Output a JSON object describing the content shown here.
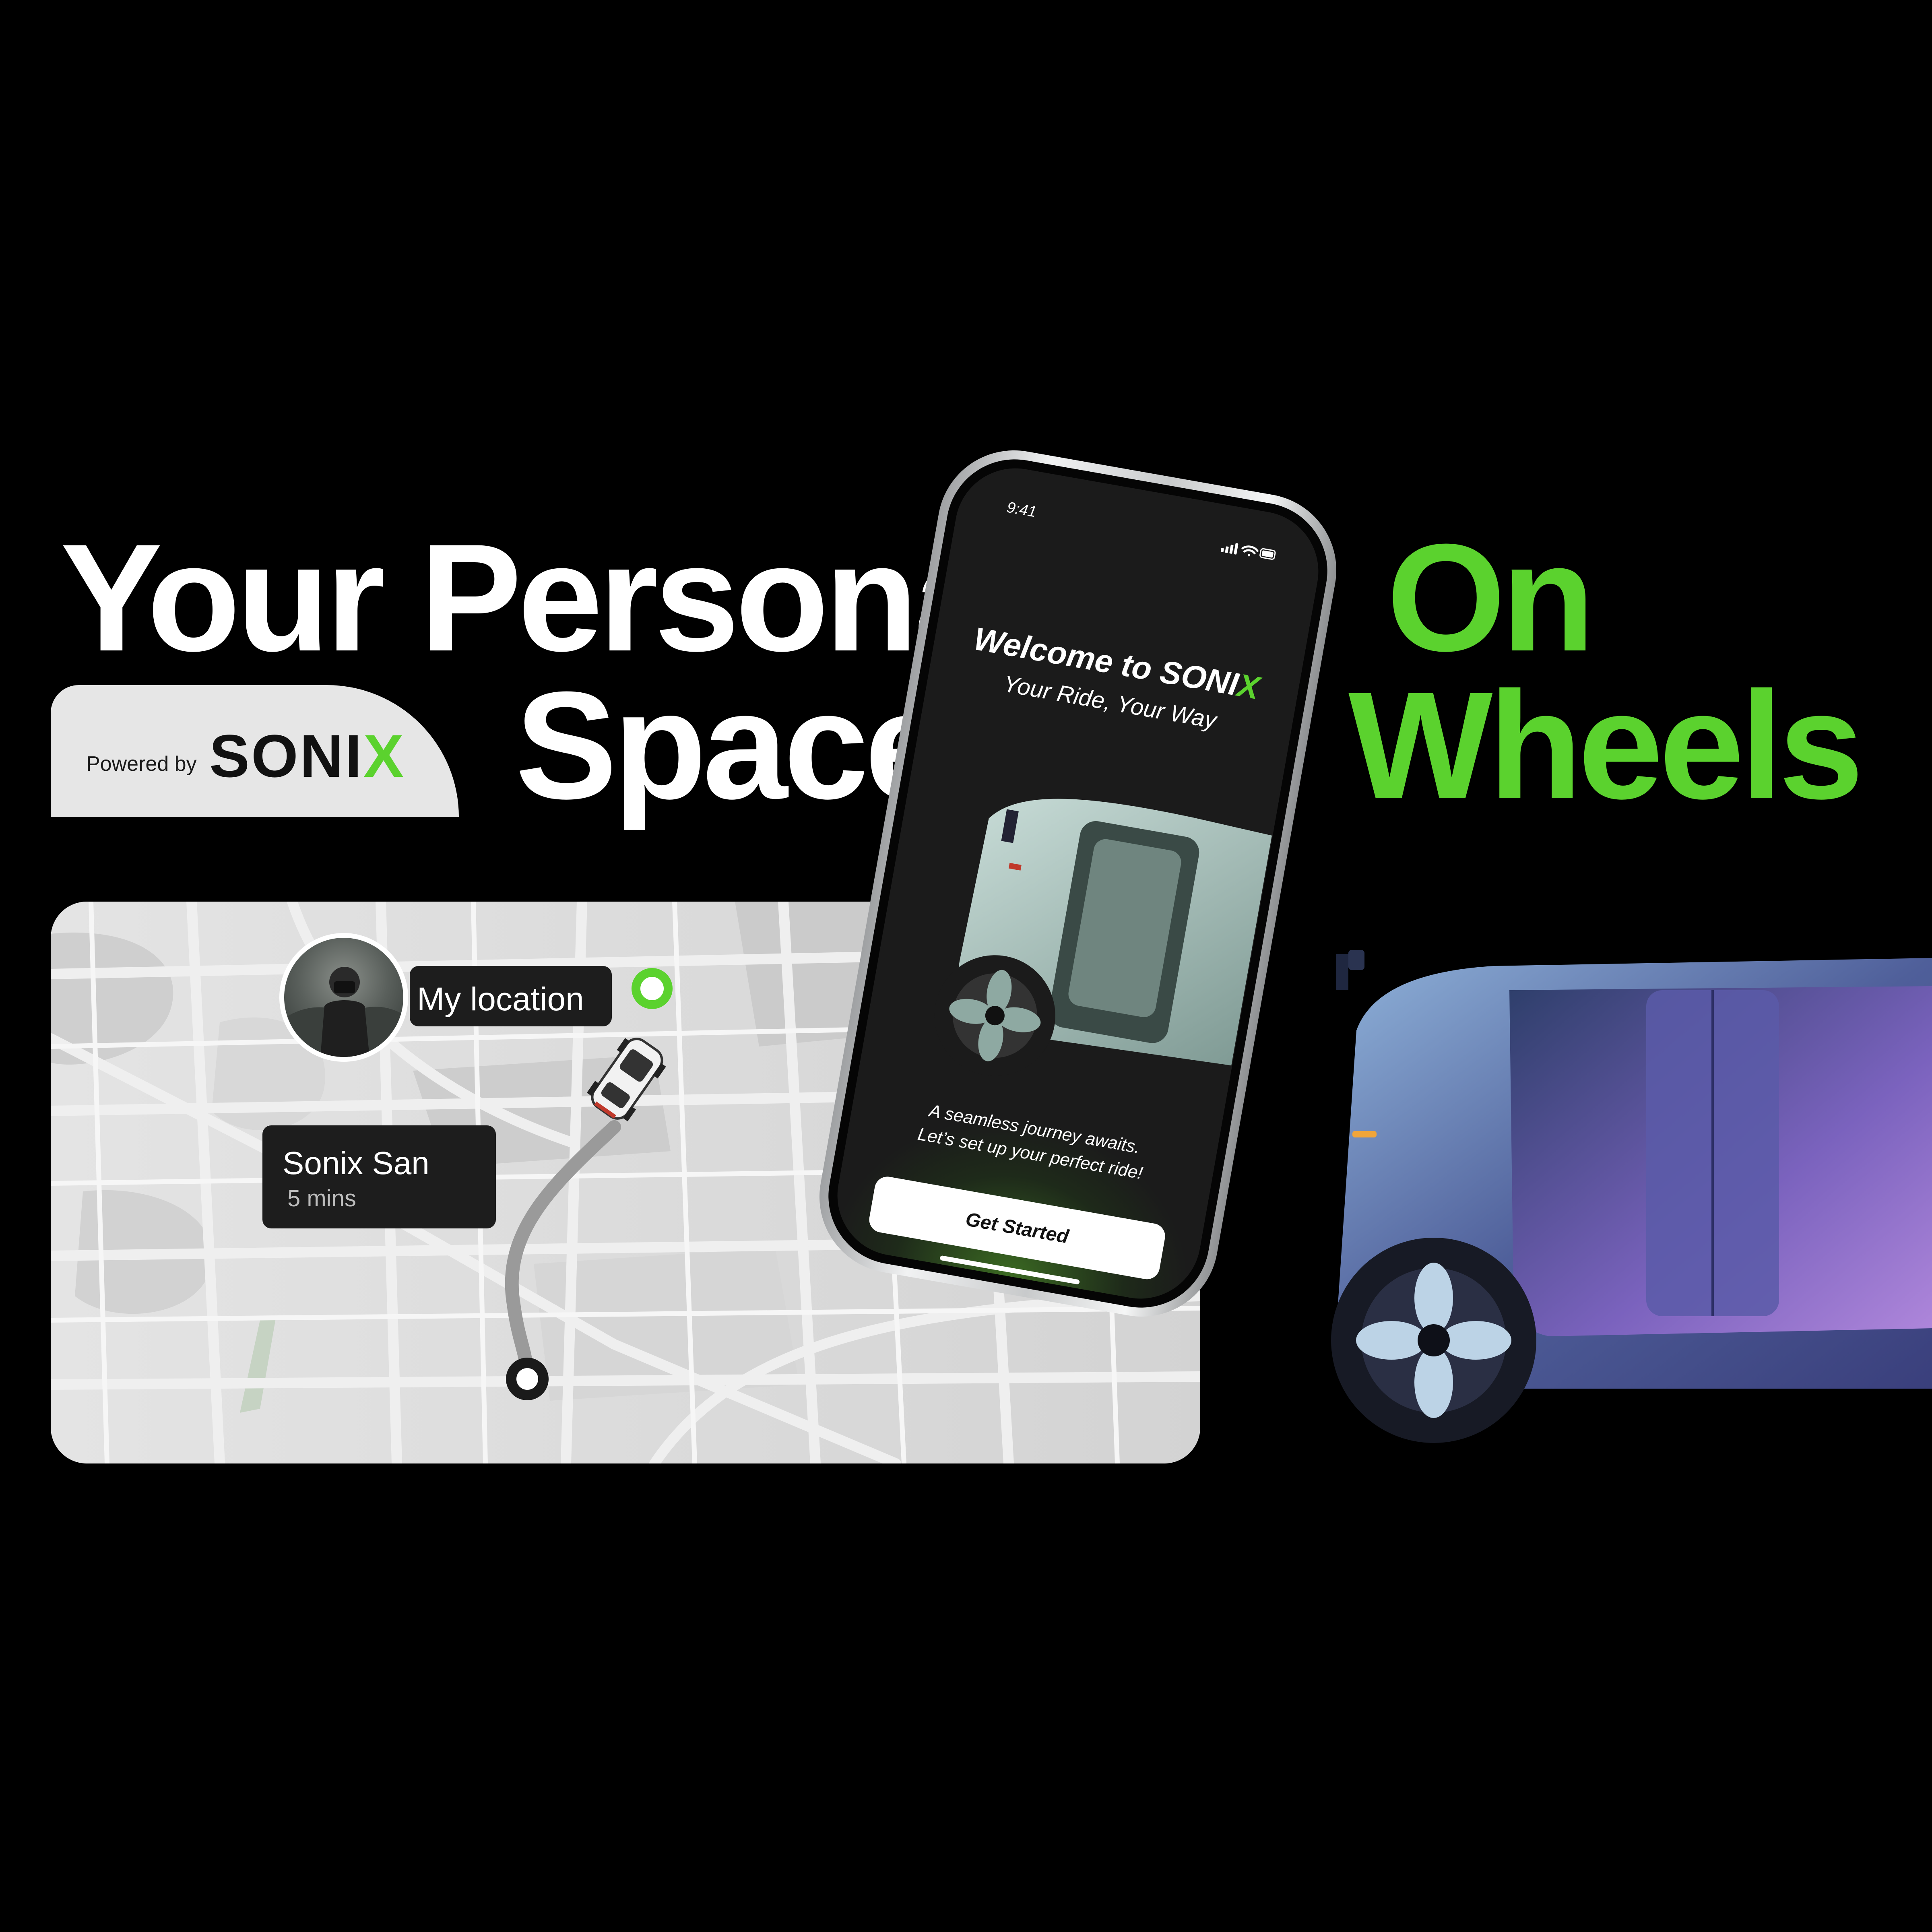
{
  "theme": {
    "accent": "#5bd22e",
    "background": "#000000",
    "card": "#e6e6e6"
  },
  "headline": {
    "line1_left": "Your Personal",
    "line2_left": "Space",
    "line1_right": "On",
    "line2_right": "Wheels"
  },
  "powered": {
    "label": "Powered by",
    "brand": "SONI",
    "brand_accent": "X"
  },
  "map": {
    "my_location_label": "My location",
    "driver_name": "Sonix San",
    "driver_eta": "5 mins"
  },
  "phone": {
    "time": "9:41",
    "welcome_prefix": "Welcome to ",
    "welcome_brand": "SONI",
    "welcome_brand_accent": "X",
    "tagline": "Your Ride, Your Way",
    "journey_line1": "A seamless journey awaits.",
    "journey_line2": "Let’s set up your perfect ride!",
    "cta_label": "Get Started",
    "icons": [
      "signal-icon",
      "wifi-icon",
      "battery-icon"
    ]
  }
}
